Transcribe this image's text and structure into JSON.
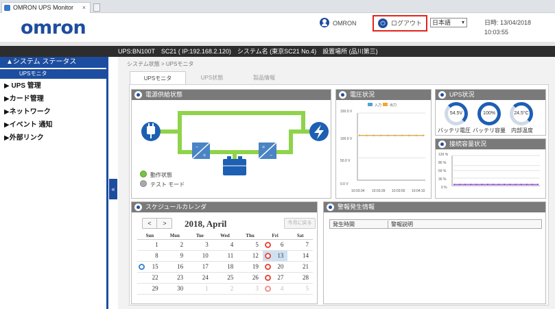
{
  "browser": {
    "tab_title": "OMRON UPS Monitor",
    "close": "×"
  },
  "header": {
    "logo": "omron",
    "user_name": "OMRON",
    "logout_label": "ログアウト",
    "language": "日本語",
    "datetime": "日時: 13/04/2018 10:03:55"
  },
  "infobar": {
    "device": "UPS:BN100T　SC21 ( IP:192.168.2.120)　システム名 (東京SC21 No.4)　設置場所 (品川第三)"
  },
  "sidebar": {
    "active_section": "▲システム ステータス",
    "active_sub": "UPSモニタ",
    "items": [
      "▶ UPS 管理",
      "▶カード管理",
      "▶ネットワーク",
      "▶イベント 通知",
      "▶外部リンク"
    ],
    "collapse": "«"
  },
  "breadcrumb": "システム状態 > UPSモニタ",
  "tabs": [
    "UPSモニタ",
    "UPS状態",
    "製品情報"
  ],
  "power_panel": {
    "title": "電源供給状態",
    "legend_active": "動作状態",
    "legend_test": "テスト モード",
    "colors": {
      "path": "#8fd34a",
      "device": "#1d5fb3",
      "inverter": "#4a84c4"
    }
  },
  "voltage_panel": {
    "title": "電圧状況",
    "legend_in": "入力",
    "legend_out": "出力",
    "chart_data": {
      "type": "line",
      "y_ticks": [
        "150.0 V",
        "100.0 V",
        "50.0 V",
        "0.0 V"
      ],
      "x_ticks": [
        "10:03:34",
        "10:03:39",
        "10:03:55",
        "10:04:10"
      ],
      "ylim": [
        0,
        150
      ],
      "series": [
        {
          "name": "入力",
          "color": "#4fa3d9",
          "values": [
            100,
            100,
            100,
            100,
            100,
            100,
            100,
            100,
            100,
            100
          ]
        },
        {
          "name": "出力",
          "color": "#f0a830",
          "values": [
            100,
            100,
            100,
            100,
            100,
            100,
            100,
            100,
            100,
            100
          ]
        }
      ]
    }
  },
  "ups_panel": {
    "title": "UPS状況",
    "gauges": [
      {
        "value": "54.5V",
        "label": "バッテリ電圧"
      },
      {
        "value": "100%",
        "label": "バッテリ容量"
      },
      {
        "value": "24.5°C",
        "label": "内部温度"
      }
    ]
  },
  "load_panel": {
    "title": "接続容量状況",
    "chart_data": {
      "type": "line",
      "y_ticks": [
        "120 %",
        "80 %",
        "60 %",
        "30 %",
        "0 %"
      ],
      "ylim": [
        0,
        120
      ],
      "series": [
        {
          "color": "#8a2be2",
          "values": [
            5,
            5,
            5,
            5,
            5,
            5,
            5,
            5,
            5,
            5,
            5,
            5,
            5,
            5,
            5,
            5
          ]
        }
      ]
    }
  },
  "calendar": {
    "title": "スケジュールカレンダ",
    "month_label": "2018, April",
    "prev": "<",
    "next": ">",
    "today_btn": "今月に戻る",
    "weekdays": [
      "Sun",
      "Mon",
      "Tue",
      "Wed",
      "Thu",
      "Fri",
      "Sat"
    ],
    "weeks": [
      [
        "1",
        "2",
        "3",
        "4",
        "5",
        "6",
        "7"
      ],
      [
        "8",
        "9",
        "10",
        "11",
        "12",
        "13",
        "14"
      ],
      [
        "15",
        "16",
        "17",
        "18",
        "19",
        "20",
        "21"
      ],
      [
        "22",
        "23",
        "24",
        "25",
        "26",
        "27",
        "28"
      ],
      [
        "29",
        "30",
        "1",
        "2",
        "3",
        "4",
        "5"
      ]
    ]
  },
  "alerts": {
    "title": "警報発生情報",
    "col_time": "発生時間",
    "col_desc": "警報説明"
  }
}
